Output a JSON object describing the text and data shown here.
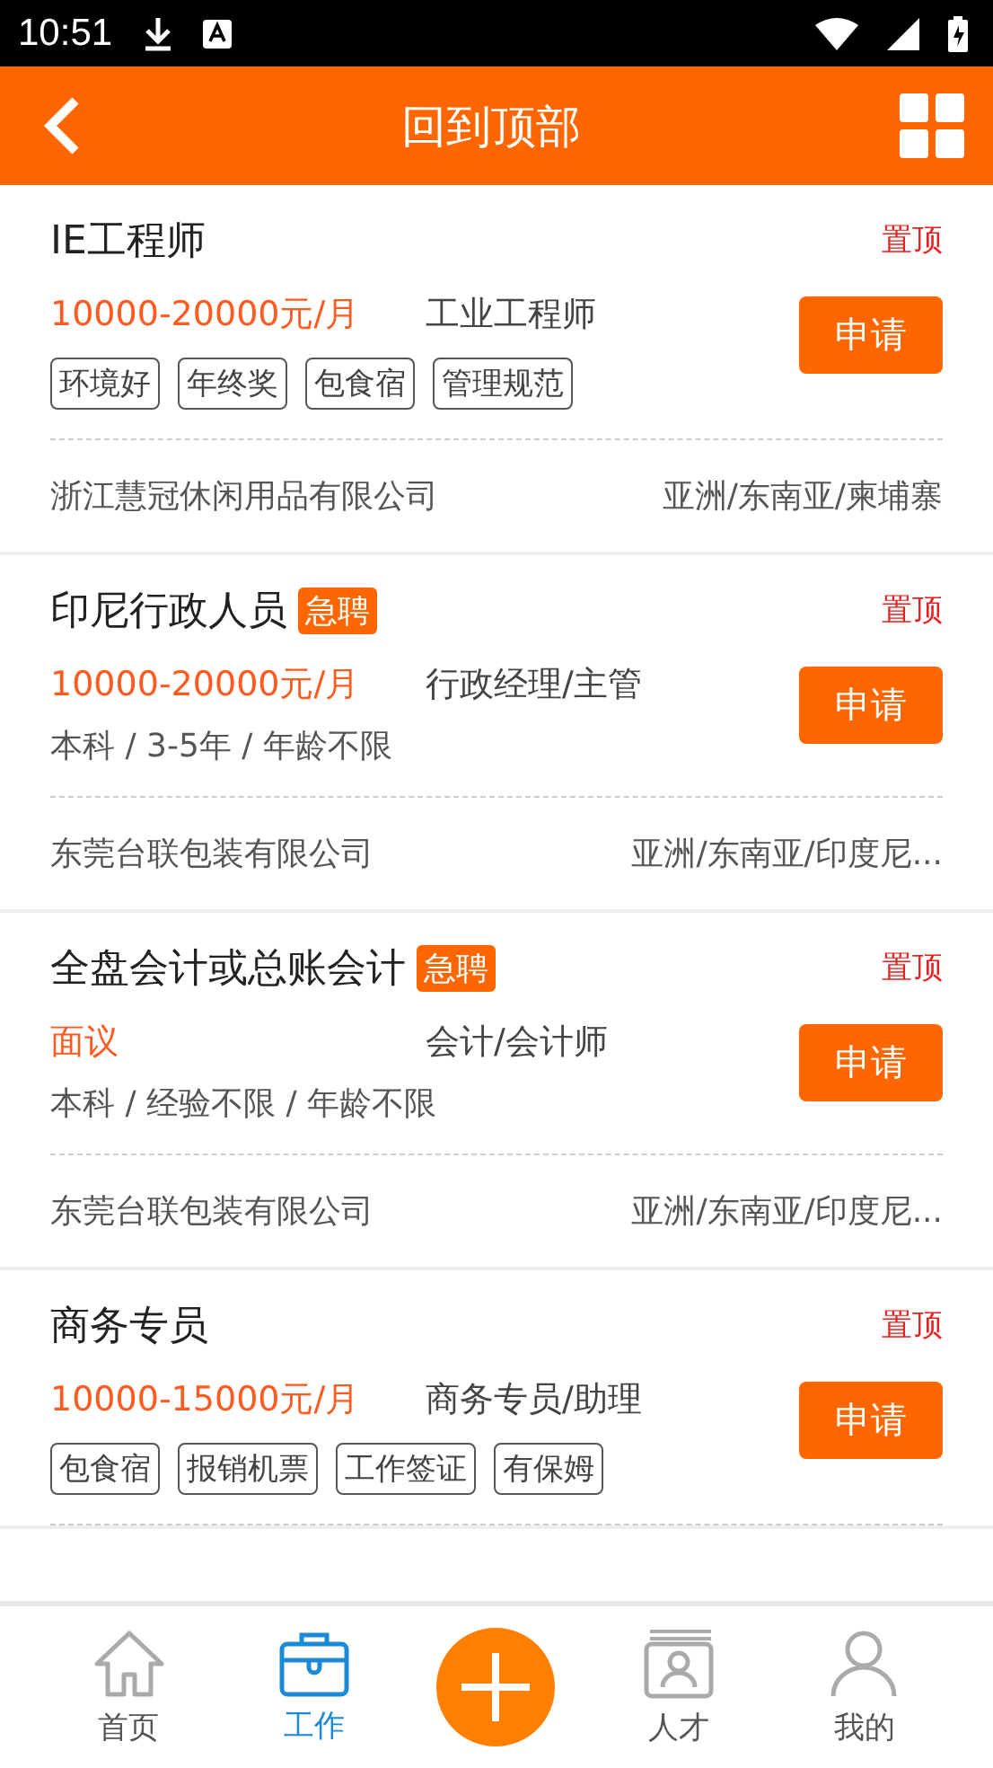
{
  "status_bar": {
    "time": "10:51"
  },
  "header": {
    "title": "回到顶部"
  },
  "jobs": [
    {
      "title": "IE工程师",
      "pinned": "置顶",
      "salary": "10000-20000元/月",
      "category": "工业工程师",
      "kind": "tags",
      "tags": [
        "环境好",
        "年终奖",
        "包食宿",
        "管理规范"
      ],
      "apply": "申请",
      "company": "浙江慧冠休闲用品有限公司",
      "location": "亚洲/东南亚/柬埔寨"
    },
    {
      "title": "印尼行政人员",
      "urgent": "急聘",
      "pinned": "置顶",
      "salary": "10000-20000元/月",
      "category": "行政经理/主管",
      "kind": "text",
      "requirements": "本科 / 3-5年 / 年龄不限",
      "apply": "申请",
      "company": "东莞台联包装有限公司",
      "location": "亚洲/东南亚/印度尼..."
    },
    {
      "title": "全盘会计或总账会计",
      "urgent": "急聘",
      "pinned": "置顶",
      "salary": "面议",
      "category": "会计/会计师",
      "kind": "text",
      "requirements": "本科 / 经验不限 / 年龄不限",
      "apply": "申请",
      "company": "东莞台联包装有限公司",
      "location": "亚洲/东南亚/印度尼..."
    },
    {
      "title": "商务专员",
      "pinned": "置顶",
      "salary": "10000-15000元/月",
      "category": "商务专员/助理",
      "kind": "tags",
      "tags": [
        "包食宿",
        "报销机票",
        "工作签证",
        "有保姆"
      ],
      "apply": "申请"
    }
  ],
  "bottom_nav": [
    {
      "kind": "home",
      "label": "首页",
      "selected": false
    },
    {
      "kind": "work",
      "label": "工作",
      "selected": true
    },
    {
      "kind": "add"
    },
    {
      "kind": "talent",
      "label": "人才",
      "selected": false
    },
    {
      "kind": "mine",
      "label": "我的",
      "selected": false
    }
  ]
}
